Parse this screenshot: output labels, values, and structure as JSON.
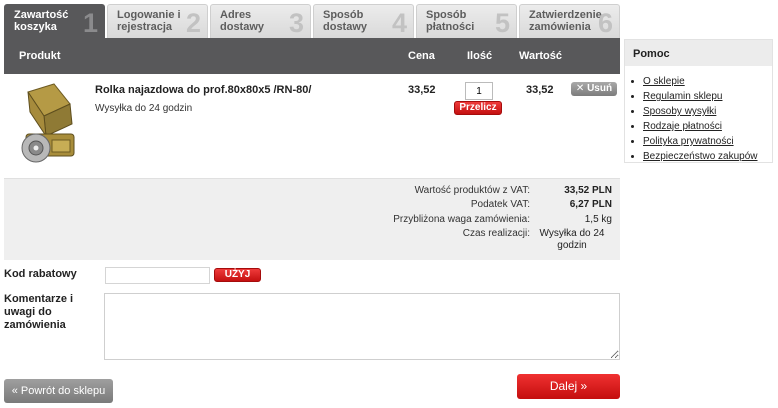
{
  "steps": [
    {
      "label": "Zawartość koszyka",
      "num": "1"
    },
    {
      "label": "Logowanie i rejestracja",
      "num": "2"
    },
    {
      "label": "Adres dostawy",
      "num": "3"
    },
    {
      "label": "Sposób dostawy",
      "num": "4"
    },
    {
      "label": "Sposób płatności",
      "num": "5"
    },
    {
      "label": "Zatwierdzenie zamówienia",
      "num": "6"
    }
  ],
  "table": {
    "headers": {
      "product": "Produkt",
      "price": "Cena",
      "qty": "Ilość",
      "value": "Wartość"
    }
  },
  "product": {
    "name": "Rolka najazdowa do prof.80x80x5 /RN-80/",
    "availability": "Wysyłka do 24 godzin",
    "price": "33,52",
    "qty": "1",
    "recalc_label": "Przelicz",
    "value": "33,52",
    "remove_label": "Usuń"
  },
  "summary": {
    "net_label": "Wartość produktów z VAT:",
    "net_value": "33,52 PLN",
    "tax_label": "Podatek VAT:",
    "tax_value": "6,27 PLN",
    "weight_label": "Przybliżona waga zamówienia:",
    "weight_value": "1,5 kg",
    "time_label": "Czas realizacji:",
    "time_value": "Wysyłka do 24 godzin"
  },
  "coupon": {
    "label": "Kod rabatowy",
    "value": "",
    "button": "UŻYJ"
  },
  "comments": {
    "label": "Komentarze i uwagi do zamówienia",
    "value": ""
  },
  "buttons": {
    "back": "«  Powrót do sklepu",
    "next": "Dalej »"
  },
  "help": {
    "title": "Pomoc",
    "links": [
      "O sklepie",
      "Regulamin sklepu",
      "Sposoby wysyłki",
      "Rodzaje płatności",
      "Polityka prywatności",
      "Bezpieczeństwo zakupów"
    ]
  },
  "colors": {
    "accent_red": "#d41414",
    "header_gray": "#58585a",
    "summary_bg": "#efefef"
  }
}
